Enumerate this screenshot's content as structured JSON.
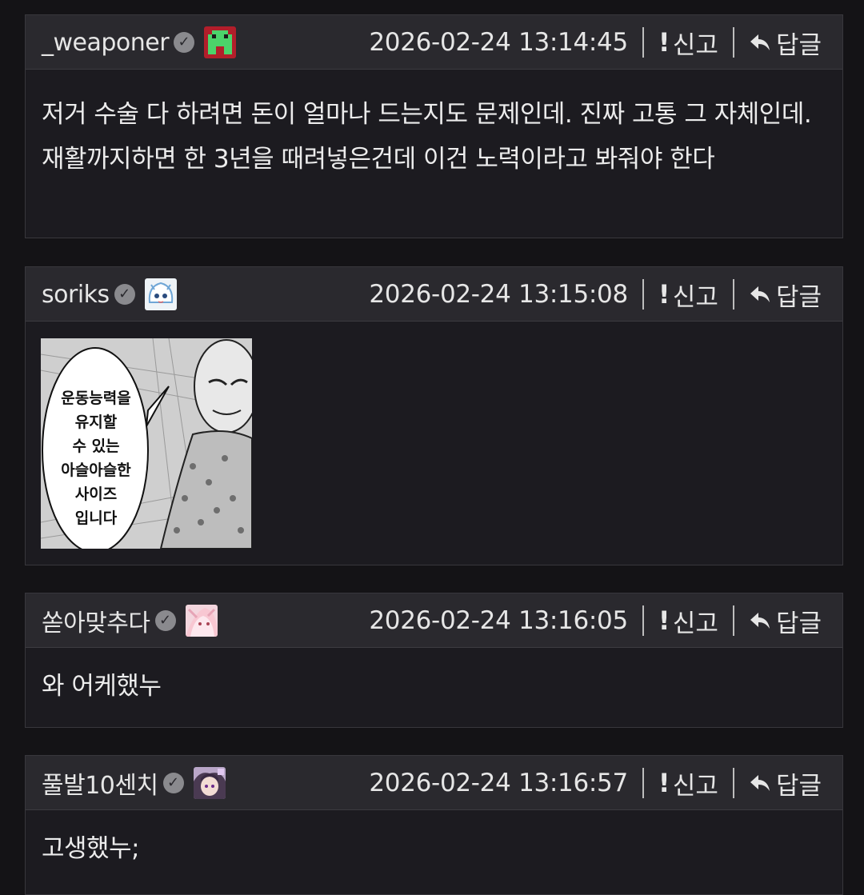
{
  "comments": [
    {
      "author": "_weaponer",
      "timestamp": "2026-02-24 13:14:45",
      "report_label": "신고",
      "reply_label": "답글",
      "text": "저거 수술 다 하려면 돈이 얼마나 드는지도 문제인데. 진짜 고통 그 자체인데. 재활까지하면 한 3년을 때려넣은건데 이건 노력이라고 봐줘야 한다",
      "avatar_icon": "green-pixel-invader-icon"
    },
    {
      "author": "soriks",
      "timestamp": "2026-02-24 13:15:08",
      "report_label": "신고",
      "reply_label": "답글",
      "avatar_icon": "anime-girl-avatar-icon",
      "image": {
        "kind": "manga-panel",
        "speech_text": "운동능력을\n유지할\n수 있는\n아슬아슬한\n사이즈\n입니다"
      }
    },
    {
      "author": "쏟아맞추다",
      "timestamp": "2026-02-24 13:16:05",
      "report_label": "신고",
      "reply_label": "답글",
      "text": "와 어케했누",
      "avatar_icon": "pink-anime-avatar-icon"
    },
    {
      "author": "풀발10센치",
      "timestamp": "2026-02-24 13:16:57",
      "report_label": "신고",
      "reply_label": "답글",
      "text": "고생했누;",
      "avatar_icon": "anime-character-avatar-icon"
    }
  ],
  "colors": {
    "background": "#141316",
    "comment_bg": "#1c1b20",
    "header_bg": "#2a292e",
    "text": "#ececec",
    "verified": "#8a8a8e"
  }
}
